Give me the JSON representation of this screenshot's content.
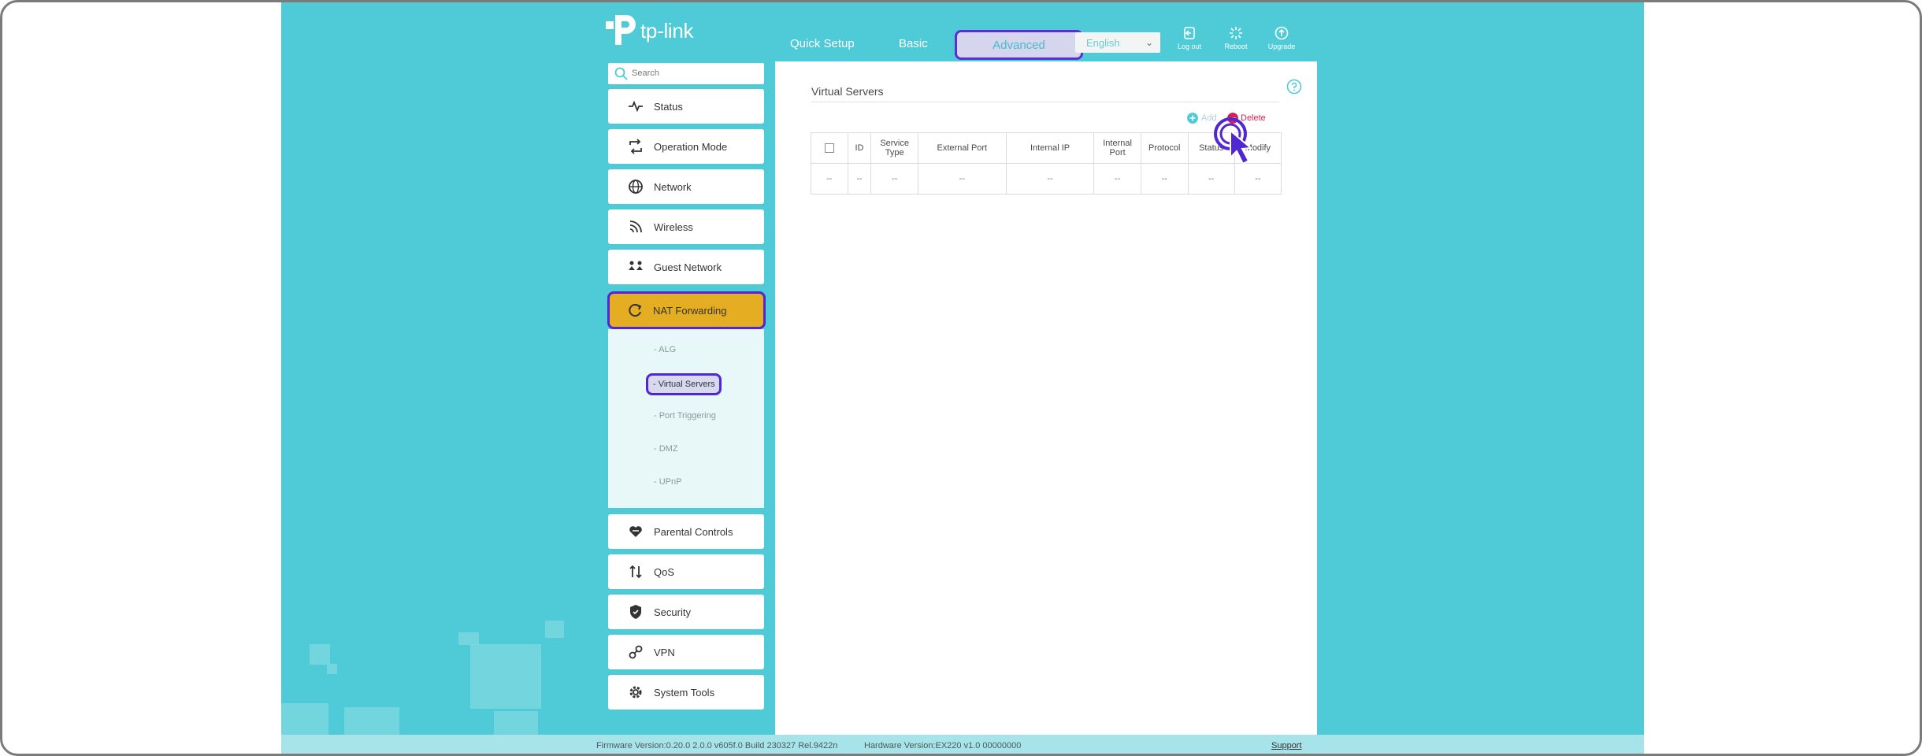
{
  "logo": {
    "text": "tp-link"
  },
  "topnav": {
    "tabs": [
      "Quick Setup",
      "Basic"
    ],
    "active_tab": "Advanced",
    "language": "English",
    "buttons": [
      {
        "label": "Log out",
        "icon": "logout-icon"
      },
      {
        "label": "Reboot",
        "icon": "reboot-icon"
      },
      {
        "label": "Upgrade",
        "icon": "upgrade-icon"
      }
    ]
  },
  "sidebar": {
    "search_placeholder": "Search",
    "items": [
      {
        "label": "Status",
        "icon": "pulse-icon"
      },
      {
        "label": "Operation Mode",
        "icon": "swap-icon"
      },
      {
        "label": "Network",
        "icon": "globe-icon"
      },
      {
        "label": "Wireless",
        "icon": "wireless-icon"
      },
      {
        "label": "Guest Network",
        "icon": "guest-icon"
      },
      {
        "label": "NAT Forwarding",
        "icon": "nat-icon"
      },
      {
        "label": "Parental Controls",
        "icon": "heart-hands-icon"
      },
      {
        "label": "QoS",
        "icon": "qos-icon"
      },
      {
        "label": "Security",
        "icon": "shield-icon"
      },
      {
        "label": "VPN",
        "icon": "vpn-icon"
      },
      {
        "label": "System Tools",
        "icon": "gear-icon"
      }
    ],
    "submenu": [
      "- ALG",
      "- Virtual Servers",
      "- Port Triggering",
      "- DMZ",
      "- UPnP"
    ]
  },
  "main": {
    "title": "Virtual Servers",
    "add_label": "Add",
    "delete_label": "Delete",
    "columns": [
      "",
      "ID",
      "Service Type",
      "External Port",
      "Internal IP",
      "Internal Port",
      "Protocol",
      "Status",
      "Modify"
    ],
    "rows": [
      [
        "--",
        "--",
        "--",
        "--",
        "--",
        "--",
        "--",
        "--",
        "--"
      ]
    ]
  },
  "footer": {
    "firmware": "Firmware Version:0.20.0 2.0.0 v605f.0 Build 230327 Rel.9422n",
    "hardware": "Hardware Version:EX220 v1.0 00000000",
    "support": "Support"
  },
  "colors": {
    "background": "#4ecbd7",
    "accent_highlight": "#5127d1",
    "active_menu": "#e5ad22",
    "delete": "#d61f58"
  }
}
